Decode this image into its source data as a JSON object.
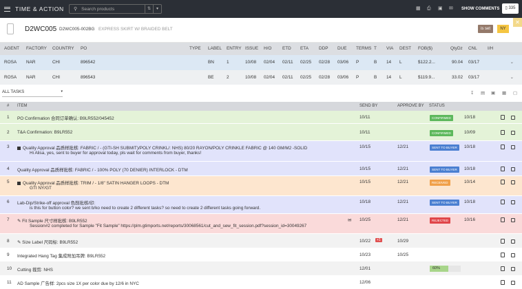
{
  "app": {
    "title": "TIME & ACTION",
    "search_placeholder": "Search products",
    "show_comments": "SHOW COMMENTS",
    "comment_count": "335"
  },
  "product": {
    "style_code": "D2WC005",
    "style_variant": "D2WC005-002BG",
    "description": "EXPRESS SKIRT W/ BRAIDED BELT",
    "badge_set": "is set",
    "badge_ny": "NY"
  },
  "po_columns": [
    "AGENT",
    "FACTORY",
    "COUNTRY",
    "PO",
    "TYPE",
    "LABEL",
    "ENTRY",
    "ISSUE",
    "H/O",
    "ETD",
    "ETA",
    "DDP",
    "DUE",
    "TERMS",
    "T",
    "VIA",
    "DEST",
    "FOB($)",
    "QtyDz",
    "CNL",
    "I/H"
  ],
  "po_rows": [
    {
      "agent": "ROSA",
      "factory": "NAR",
      "country": "CHI",
      "po": "896542",
      "type": "",
      "label": "BN",
      "entry": "1",
      "issue": "10/08",
      "ho": "02/04",
      "etd": "02/11",
      "eta": "02/25",
      "ddp": "02/28",
      "due": "03/06",
      "terms": "P",
      "t": "B",
      "via": "14",
      "dest": "L",
      "fob": "$122.2...",
      "qty": "90.04",
      "cnl": "03/17",
      "ih": ""
    },
    {
      "agent": "ROSA",
      "factory": "NAR",
      "country": "CHI",
      "po": "896543",
      "type": "",
      "label": "BE",
      "entry": "2",
      "issue": "10/08",
      "ho": "02/04",
      "etd": "02/11",
      "eta": "02/25",
      "ddp": "02/28",
      "due": "03/06",
      "terms": "P",
      "t": "B",
      "via": "14",
      "dest": "L",
      "fob": "$119.9...",
      "qty": "33.02",
      "cnl": "03/17",
      "ih": ""
    }
  ],
  "filter": {
    "label": "ALL TASKS"
  },
  "task_columns": {
    "num": "#",
    "item": "ITEM",
    "send_by": "SEND BY",
    "approve_by": "APPROVE BY",
    "status": "STATUS"
  },
  "tasks": [
    {
      "num": "1",
      "item": "PO Confirmation 合同订单确认: B9LR552/045452",
      "note": "",
      "send_by": "10/11",
      "approve_by": "",
      "status": "CONFIRMED",
      "status_color": "#5cb85c",
      "date": "10/18",
      "bg": "#e4f3d8",
      "bullet": false
    },
    {
      "num": "2",
      "item": "T&A Confirmation: B9LR552",
      "note": "",
      "send_by": "10/11",
      "approve_by": "",
      "status": "CONFIRMED",
      "status_color": "#5cb85c",
      "date": "10/09",
      "bg": "#e4f3d8",
      "bullet": false
    },
    {
      "num": "3",
      "item": "Quality Approval 品质样批核: FABRIC / - (GTI-SH SUBMIT)/POLY CRINKL/: NHS) 80/20 RAYON/POLY CRINKLE FABRIC @ 140 GM/M2 -SOLID",
      "note": "Hi Alisa, yes, sent to buyer for approval today, pls wait for comments from buyer, thanks!",
      "send_by": "10/15",
      "approve_by": "12/21",
      "status": "SENT TO BUYER",
      "status_color": "#4a7fd1",
      "date": "10/18",
      "bg": "#e1e3fb",
      "bullet": true
    },
    {
      "num": "4",
      "item": "Quality Approval 品质样批核: FABRIC / - 100% POLY (70 DENIER) INTERLOCK - DTM",
      "note": "",
      "send_by": "10/15",
      "approve_by": "12/21",
      "status": "SENT TO BUYER",
      "status_color": "#4a7fd1",
      "date": "10/18",
      "bg": "#e1e3fb",
      "bullet": false
    },
    {
      "num": "5",
      "item": "Quality Approval 品质样批核: TRIM / - 1/8\" SATIN HANGER LOOPS - DTM",
      "note": "GTI NY/GT",
      "send_by": "10/15",
      "approve_by": "12/21",
      "status": "RECEIVED",
      "status_color": "#f0a04b",
      "date": "10/14",
      "bg": "#fde6cf",
      "bullet": true
    },
    {
      "num": "6",
      "item": "Lab-Dip/Strike-off approval 色削批核/印:",
      "note": "is this for button color? we sent b/ko need to create 2 different tasks? so need to create 2 different tasks going forward.",
      "send_by": "10/18",
      "approve_by": "12/21",
      "status": "SENT TO BUYER",
      "status_color": "#4a7fd1",
      "date": "10/18",
      "bg": "#e1e3fb",
      "bullet": false
    },
    {
      "num": "7",
      "item": "Fit Sample 尺寸样批核: B9LR552",
      "note": "Session#2 completed for Sample \"Fit Sample\" https://plm.gtimports.net/reports/30068561/cut_and_sew_fit_session.pdf?session_id=30049267",
      "send_by": "10/25",
      "approve_by": "12/21",
      "status": "REJECTED",
      "status_color": "#e0464a",
      "date": "10/16",
      "bg": "#fadada",
      "bullet": false
    },
    {
      "num": "8",
      "item": "Size Label 尺码标: B9LR552",
      "note": "",
      "send_by": "10/22",
      "late": "+1",
      "approve_by": "10/29",
      "status": "",
      "status_color": "",
      "date": "",
      "bg": "#f2f2f2",
      "bullet": false
    },
    {
      "num": "9",
      "item": "Integrated Hang Tag 集成附加吊牌: B9LR552",
      "note": "",
      "send_by": "10/23",
      "approve_by": "10/25",
      "status": "",
      "status_color": "",
      "date": "",
      "bg": "#ffffff",
      "bullet": false
    },
    {
      "num": "10",
      "item": "Cutting 裁剪: NHS",
      "note": "",
      "send_by": "12/01",
      "approve_by": "",
      "status": "60%",
      "progress": 0.6,
      "status_color": "",
      "date": "",
      "bg": "#f2f2f2",
      "bullet": false
    },
    {
      "num": "11",
      "item": "AD Sample 广告样: 2pcs size 1X per color due by 12/6 in NYC",
      "note": "",
      "send_by": "12/06",
      "approve_by": "",
      "status": "",
      "status_color": "",
      "date": "",
      "bg": "#ffffff",
      "bullet": false
    }
  ]
}
